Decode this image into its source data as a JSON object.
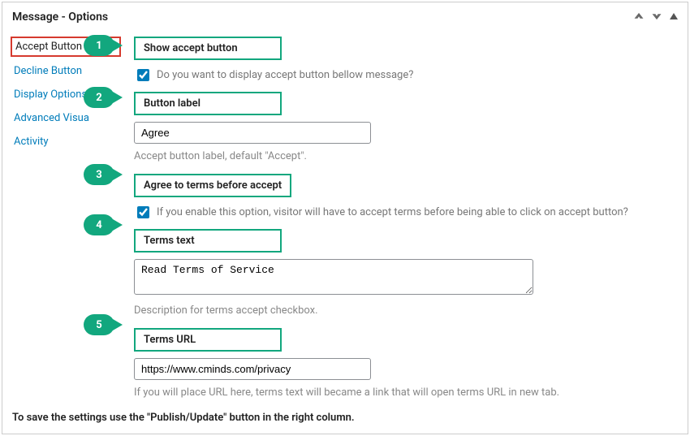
{
  "header": {
    "title": "Message - Options"
  },
  "sidebar": {
    "items": [
      {
        "label": "Accept Button",
        "active": true
      },
      {
        "label": "Decline Button"
      },
      {
        "label": "Display Options"
      },
      {
        "label": "Advanced Visua"
      },
      {
        "label": "Activity"
      }
    ]
  },
  "callouts": {
    "c1": "1",
    "c2": "2",
    "c3": "3",
    "c4": "4",
    "c5": "5"
  },
  "fields": {
    "show_accept": {
      "label": "Show accept button",
      "help": "Do you want to display accept button bellow message?"
    },
    "button_label": {
      "label": "Button label",
      "value": "Agree",
      "hint": "Accept button label, default \"Accept\"."
    },
    "agree_first": {
      "label": "Agree to terms before accept",
      "help": "If you enable this option, visitor will have to accept terms before being able to click on accept button?"
    },
    "terms_text": {
      "label": "Terms text",
      "value": "Read Terms of Service",
      "hint": "Description for terms accept checkbox."
    },
    "terms_url": {
      "label": "Terms URL",
      "value": "https://www.cminds.com/privacy",
      "hint": "If you will place URL here, terms text will became a link that will open terms URL in new tab."
    }
  },
  "footer": {
    "text": "To save the settings use the \"Publish/Update\" button in the right column."
  }
}
